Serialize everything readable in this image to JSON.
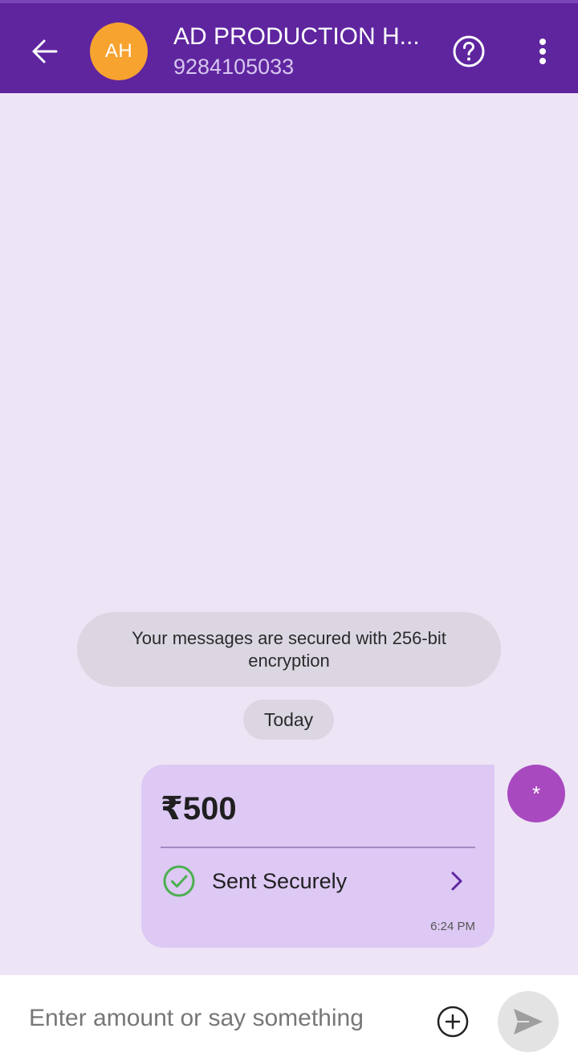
{
  "header": {
    "avatar_initials": "AH",
    "contact_name": "AD PRODUCTION H...",
    "contact_phone": "9284105033",
    "back_icon": "arrow-left-icon",
    "help_icon": "question-circle-icon",
    "more_icon": "more-vertical-icon"
  },
  "chat": {
    "encryption_notice": "Your messages are secured with 256-bit encryption",
    "date_label": "Today",
    "message": {
      "amount": "₹500",
      "status": "Sent Securely",
      "time": "6:24 PM",
      "sender_avatar": "*"
    }
  },
  "composer": {
    "placeholder": "Enter amount or say something",
    "value": ""
  },
  "colors": {
    "header_bg": "#5f259f",
    "chat_bg": "#ede5f6",
    "avatar_bg": "#f7a330",
    "card_bg": "#ddc9f4",
    "success_green": "#4caf50",
    "sender_avatar_bg": "#a849bf"
  }
}
